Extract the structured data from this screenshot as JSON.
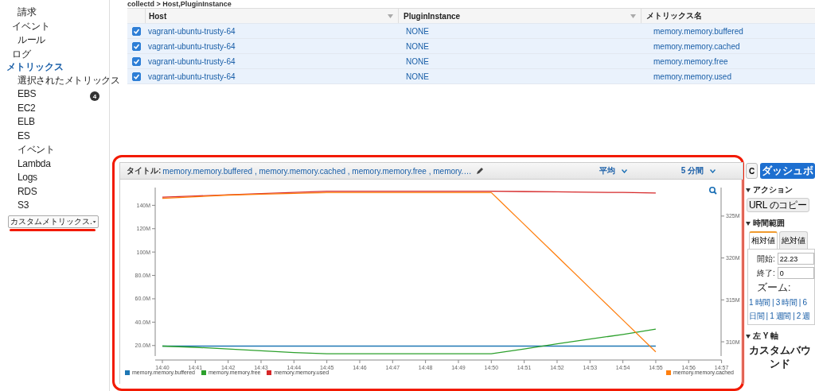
{
  "breadcrumb": "collectd > Host,PluginInstance",
  "sidebar": {
    "orphan_items": [
      {
        "label": "請求"
      }
    ],
    "items": [
      {
        "label": "イベント",
        "selected": false,
        "children": [
          {
            "label": "ルール"
          }
        ]
      },
      {
        "label": "ログ",
        "selected": false
      },
      {
        "label": "メトリックス",
        "selected": true,
        "children": [
          {
            "label": "選択されたメトリックス",
            "badge": "4"
          },
          {
            "label": "EBS"
          },
          {
            "label": "EC2"
          },
          {
            "label": "ELB"
          },
          {
            "label": "ES"
          },
          {
            "label": "イベント"
          },
          {
            "label": "Lambda"
          },
          {
            "label": "Logs"
          },
          {
            "label": "RDS"
          },
          {
            "label": "S3"
          }
        ]
      }
    ],
    "dropdown": {
      "value": "カスタムメトリックス."
    }
  },
  "table": {
    "columns": [
      {
        "label": "Host",
        "sortable": true
      },
      {
        "label": "PluginInstance",
        "sortable": true
      },
      {
        "label": "メトリックス名",
        "sortable": false
      }
    ],
    "rows": [
      {
        "checked": true,
        "cells": [
          "vagrant-ubuntu-trusty-64",
          "NONE",
          "memory.memory.buffered"
        ]
      },
      {
        "checked": true,
        "cells": [
          "vagrant-ubuntu-trusty-64",
          "NONE",
          "memory.memory.cached"
        ]
      },
      {
        "checked": true,
        "cells": [
          "vagrant-ubuntu-trusty-64",
          "NONE",
          "memory.memory.free"
        ]
      },
      {
        "checked": true,
        "cells": [
          "vagrant-ubuntu-trusty-64",
          "NONE",
          "memory.memory.used"
        ]
      }
    ]
  },
  "graph": {
    "title_label": "タイトル:",
    "title": "memory.memory.buffered , memory.memory.cached , memory.memory.free , memory.…",
    "statistic": "平均",
    "period": "5 分間",
    "chart_data": {
      "type": "line",
      "x": [
        "14:40",
        "14:41",
        "14:42",
        "14:43",
        "14:44",
        "14:45",
        "14:46",
        "14:47",
        "14:48",
        "14:49",
        "14:50",
        "14:51",
        "14:52",
        "14:53",
        "14:54",
        "14:55",
        "14:56",
        "14:57"
      ],
      "ylim": [
        11,
        155.2
      ],
      "y2lim": [
        308.3,
        328.4
      ],
      "yticks": [
        {
          "value": 20,
          "label": "20.0M"
        },
        {
          "value": 40,
          "label": "40.0M"
        },
        {
          "value": 60,
          "label": "60.0M"
        },
        {
          "value": 80,
          "label": "80.0M"
        },
        {
          "value": 100,
          "label": "100M"
        },
        {
          "value": 120,
          "label": "120M"
        },
        {
          "value": 140,
          "label": "140M"
        }
      ],
      "y2ticks": [
        {
          "value": 310,
          "label": "310M"
        },
        {
          "value": 315,
          "label": "315M"
        },
        {
          "value": 320,
          "label": "320M"
        },
        {
          "value": 325,
          "label": "325M"
        }
      ],
      "series": [
        {
          "name": "memory.memory.buffered",
          "color": "#1f77b4",
          "values": [
            19.5,
            19.5,
            19.5,
            19.5,
            19.5,
            19.5,
            19.5,
            19.5,
            19.5,
            19.5,
            19.5,
            19.5,
            19.5,
            19.5,
            19.5,
            19.5,
            null,
            null
          ]
        },
        {
          "name": "memory.memory.free",
          "color": "#2ca02c",
          "values": [
            19.5,
            18.5,
            17,
            15.5,
            14,
            13,
            13,
            13,
            13,
            13,
            13,
            17,
            21.5,
            25.5,
            29.5,
            34,
            null,
            null
          ]
        },
        {
          "name": "memory.memory.used",
          "color": "#d62728",
          "values": [
            147,
            148,
            149,
            150,
            151,
            152,
            152,
            152,
            152,
            152,
            152,
            151.8,
            151.5,
            151.2,
            151,
            150.5,
            null,
            null
          ]
        },
        {
          "name": "memory.memory.cached",
          "color": "#ff7f0e",
          "axis": "y2",
          "values": [
            327.1,
            327.3,
            327.5,
            327.6,
            327.7,
            327.8,
            327.8,
            327.8,
            327.8,
            327.8,
            327.8,
            324.0,
            320.2,
            316.4,
            312.6,
            308.8,
            null,
            null
          ]
        }
      ]
    }
  },
  "right_panel": {
    "refresh": "C",
    "dashboard_button": "ダッシュボ",
    "actions_heading": "アクション",
    "copy_url_button": "URL のコピー",
    "time_range_heading": "時間範囲",
    "tabs": [
      {
        "label": "相対値",
        "selected": true
      },
      {
        "label": "絶対値",
        "selected": false
      }
    ],
    "start_label": "開始:",
    "start_value": "22.23",
    "end_label": "終了:",
    "end_value": "0",
    "zoom_label": "ズーム:",
    "zoom_links": [
      "1 時間 | 3 時間 | 6",
      "日間 | 1 週間 | 2 週"
    ],
    "left_y_heading": "左 Y 軸",
    "custom_bound_label": "カスタムバウンド"
  }
}
